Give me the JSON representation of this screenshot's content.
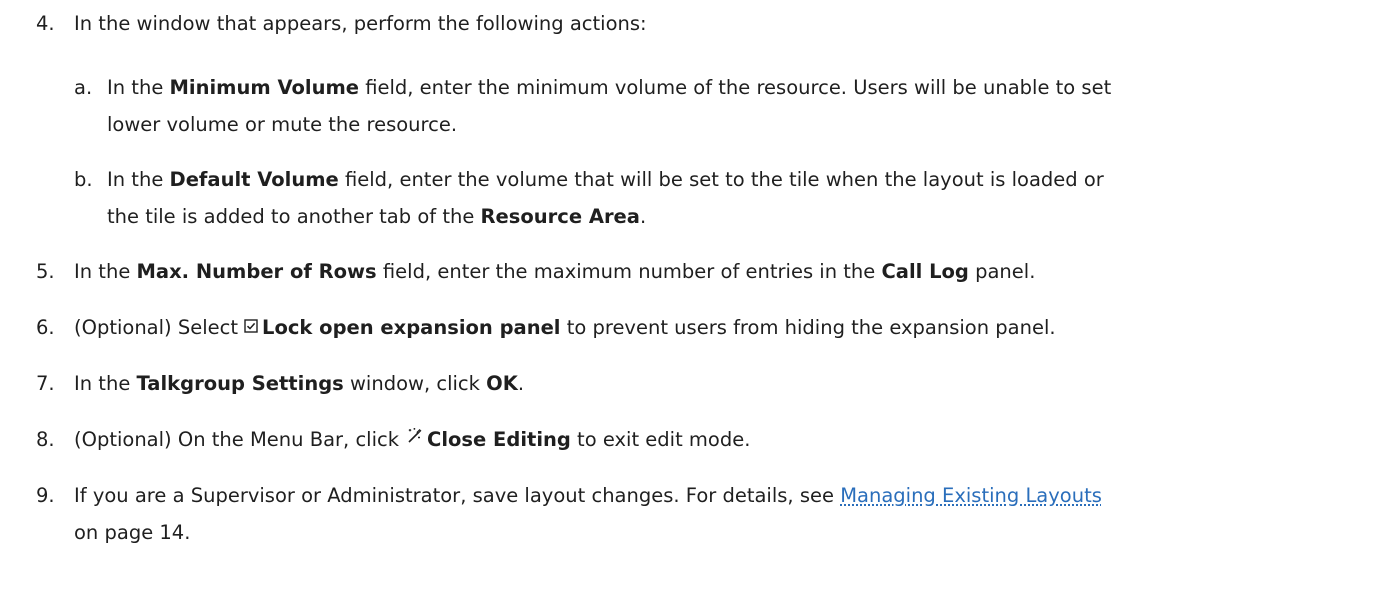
{
  "steps": {
    "s4": {
      "num": "4.",
      "text": "In the window that appears, perform the following actions:"
    },
    "s4a": {
      "num": "a.",
      "pre": "In the ",
      "bold": "Minimum Volume",
      "post": " field, enter the minimum volume of the resource. Users will be unable to set",
      "cont": "lower volume or mute the resource."
    },
    "s4b": {
      "num": "b.",
      "pre": "In the ",
      "bold": "Default Volume",
      "post": " field, enter the volume that will be set to the tile when the layout is loaded or",
      "cont_pre": "the tile is added to another tab of the ",
      "cont_bold": "Resource Area",
      "cont_post": "."
    },
    "s5": {
      "num": "5.",
      "pre": "In the ",
      "bold1": "Max. Number of Rows",
      "mid": " field, enter the maximum number of entries in the ",
      "bold2": "Call Log",
      "post": " panel."
    },
    "s6": {
      "num": "6.",
      "pre": "(Optional) Select",
      "icon": "checkbox-checked-icon",
      "bold": "Lock open expansion panel",
      "post": " to prevent users from hiding the expansion panel."
    },
    "s7": {
      "num": "7.",
      "pre": "In the ",
      "bold1": "Talkgroup Settings",
      "mid": " window, click ",
      "bold2": "OK",
      "post": "."
    },
    "s8": {
      "num": "8.",
      "pre": "(Optional) On the Menu Bar, click",
      "icon": "close-editing-wand-icon",
      "bold": "Close Editing",
      "post": " to exit edit mode."
    },
    "s9": {
      "num": "9.",
      "pre": "If you are a Supervisor or Administrator, save layout changes. For details, see ",
      "link": "Managing Existing Layouts",
      "cont": "on page 14."
    }
  },
  "colors": {
    "text": "#1f1f1f",
    "link": "#2a6ebb"
  }
}
